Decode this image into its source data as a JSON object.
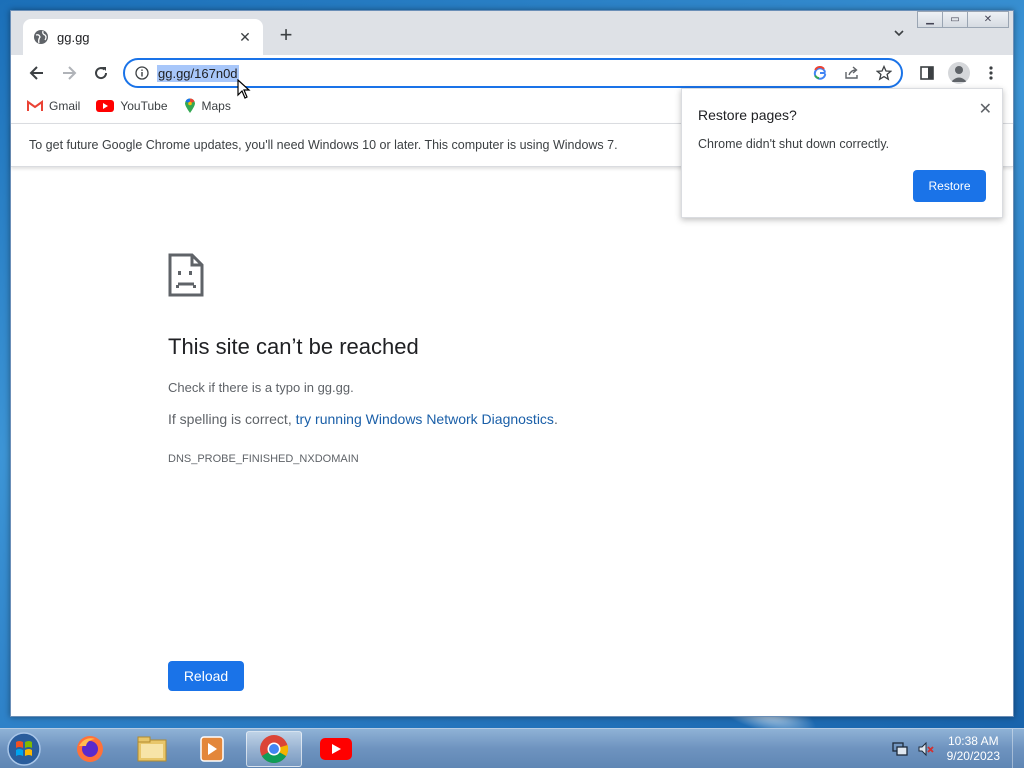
{
  "window": {
    "tab_title": "gg.gg",
    "tab_close": "✕",
    "new_tab": "+",
    "win_minimize": "▁",
    "win_maximize": "▭",
    "win_close": "✕"
  },
  "toolbar": {
    "url": "gg.gg/167n0d",
    "icons": [
      "back-icon",
      "forward-icon",
      "reload-icon",
      "site-info-icon",
      "google-lens-icon",
      "share-icon",
      "bookmark-star-icon",
      "side-panel-icon",
      "profile-icon",
      "menu-icon"
    ]
  },
  "bookmarks": [
    {
      "label": "Gmail",
      "icon": "gmail-icon"
    },
    {
      "label": "YouTube",
      "icon": "youtube-icon"
    },
    {
      "label": "Maps",
      "icon": "maps-icon"
    }
  ],
  "infobar": {
    "message": "To get future Google Chrome updates, you'll need Windows 10 or later. This computer is using Windows 7."
  },
  "error_page": {
    "title": "This site can’t be reached",
    "line1": "Check if there is a typo in gg.gg.",
    "line2_prefix": "If spelling is correct, ",
    "line2_link": "try running Windows Network Diagnostics",
    "line2_suffix": ".",
    "code": "DNS_PROBE_FINISHED_NXDOMAIN",
    "reload_label": "Reload"
  },
  "restore_popup": {
    "title": "Restore pages?",
    "body": "Chrome didn't shut down correctly.",
    "button": "Restore",
    "close": "✕"
  },
  "taskbar": {
    "apps": [
      "firefox-icon",
      "file-explorer-icon",
      "media-player-icon",
      "chrome-icon",
      "youtube-icon"
    ],
    "time": "10:38 AM",
    "date": "9/20/2023"
  },
  "colors": {
    "accent": "#1a73e8",
    "link": "#1a5fa8",
    "selection": "#a8c7fa"
  }
}
